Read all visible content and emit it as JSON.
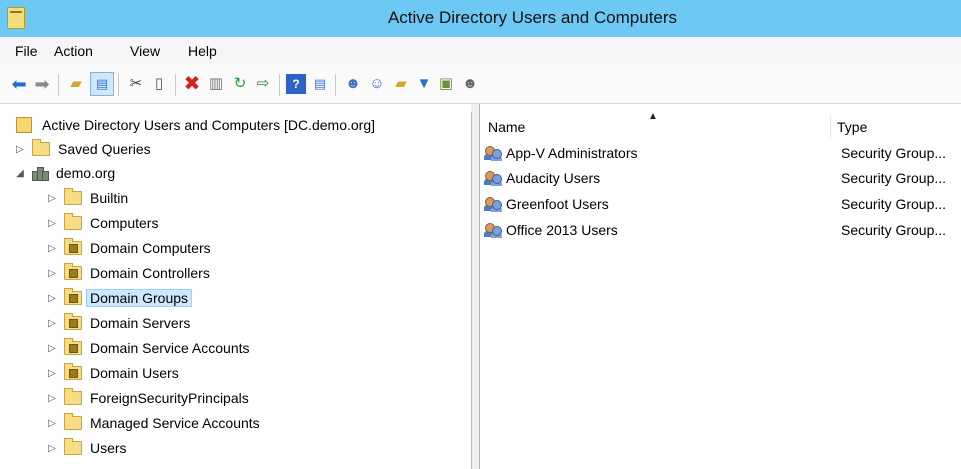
{
  "window": {
    "title": "Active Directory Users and Computers"
  },
  "menu": [
    {
      "label": "File"
    },
    {
      "label": "Action"
    },
    {
      "label": "View"
    },
    {
      "label": "Help"
    }
  ],
  "toolbar": {
    "icons": [
      "back-icon",
      "forward-icon",
      "up-one-level-icon",
      "show-hide-console-tree-icon",
      "cut-icon",
      "paste-icon",
      "delete-icon",
      "properties-icon",
      "refresh-icon",
      "export-list-icon",
      "help-icon",
      "show-hide-action-pane-icon",
      "new-user-icon",
      "new-group-icon",
      "new-ou-icon",
      "filter-icon",
      "find-icon",
      "add-to-group-icon"
    ]
  },
  "tree": {
    "root": "Active Directory Users and Computers [DC.demo.org]",
    "saved_queries": "Saved Queries",
    "domain": "demo.org",
    "children": [
      {
        "label": "Builtin",
        "type": "container"
      },
      {
        "label": "Computers",
        "type": "container"
      },
      {
        "label": "Domain Computers",
        "type": "ou"
      },
      {
        "label": "Domain Controllers",
        "type": "ou"
      },
      {
        "label": "Domain Groups",
        "type": "ou",
        "selected": true
      },
      {
        "label": "Domain Servers",
        "type": "ou"
      },
      {
        "label": "Domain Service Accounts",
        "type": "ou"
      },
      {
        "label": "Domain Users",
        "type": "ou"
      },
      {
        "label": "ForeignSecurityPrincipals",
        "type": "container"
      },
      {
        "label": "Managed Service Accounts",
        "type": "container"
      },
      {
        "label": "Users",
        "type": "container"
      }
    ]
  },
  "list": {
    "columns": {
      "name": "Name",
      "type": "Type"
    },
    "rows": [
      {
        "name": "App-V Administrators",
        "type": "Security Group..."
      },
      {
        "name": "Audacity Users",
        "type": "Security Group..."
      },
      {
        "name": "Greenfoot Users",
        "type": "Security Group..."
      },
      {
        "name": "Office 2013 Users",
        "type": "Security Group..."
      }
    ]
  }
}
